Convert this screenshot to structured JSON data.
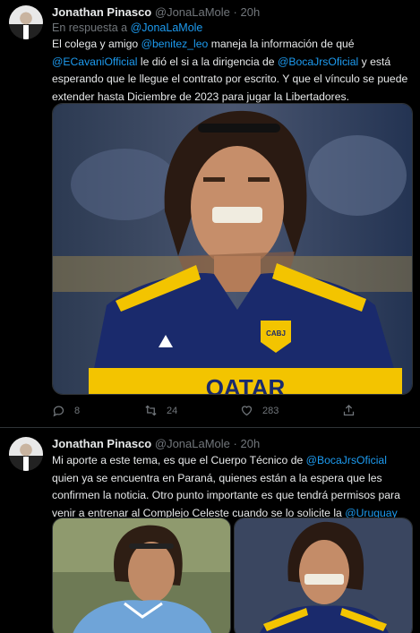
{
  "tweets": [
    {
      "author_name": "Jonathan Pinasco",
      "handle": "@JonaLaMole",
      "separator": "·",
      "time": "20h",
      "reply_prefix": "En respuesta a",
      "reply_to": "@JonaLaMole",
      "text": {
        "p1": "El colega y amigo ",
        "m1": "@benitez_leo",
        "p2": " maneja la información de qué",
        "m2": "@ECavaniOfficial",
        "p3": " le dió el si a la dirigencia de ",
        "m3": "@BocaJrsOficial",
        "p4": " y está esperando que le llegue el contrato por escrito. Y que el vínculo se puede extender hasta Diciembre de 2023 para jugar la Libertadores."
      },
      "actions": {
        "replies": "8",
        "retweets": "24",
        "likes": "283"
      }
    },
    {
      "author_name": "Jonathan Pinasco",
      "handle": "@JonaLaMole",
      "separator": "·",
      "time": "20h",
      "text": {
        "p1": "Mi aporte a este tema, es que el Cuerpo Técnico de ",
        "m1": "@BocaJrsOficial",
        "p2": " quien ya se encuentra en Paraná, quienes están a la espera que les confirmen la noticia. Otro punto importante es que tendrá permisos para venir a entrenar al Complejo Celeste cuando se lo solicite la ",
        "m2": "@Uruguay"
      }
    }
  ],
  "jersey_text": "QATAR",
  "badge_text": "CABJ",
  "colors": {
    "background": "#000000",
    "link": "#1d9bf0",
    "muted": "#71767b",
    "boca_blue": "#1a2a6c",
    "boca_gold": "#f3c400"
  },
  "icons": [
    "reply-icon",
    "retweet-icon",
    "like-icon",
    "share-icon"
  ]
}
